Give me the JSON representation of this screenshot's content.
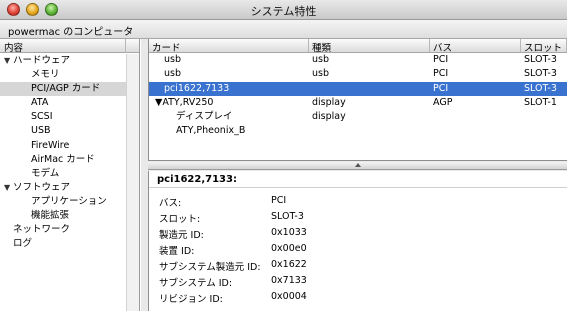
{
  "window": {
    "title": "システム特性"
  },
  "machine": {
    "name": "powermac のコンピュータ"
  },
  "sidebar": {
    "header": "内容",
    "items": [
      {
        "label": "ハードウェア",
        "level": 0,
        "disclosure": "▼"
      },
      {
        "label": "メモリ",
        "level": 1
      },
      {
        "label": "PCI/AGP カード",
        "level": 1,
        "selected": true
      },
      {
        "label": "ATA",
        "level": 1
      },
      {
        "label": "SCSI",
        "level": 1
      },
      {
        "label": "USB",
        "level": 1
      },
      {
        "label": "FireWire",
        "level": 1
      },
      {
        "label": "AirMac カード",
        "level": 1
      },
      {
        "label": "モデム",
        "level": 1
      },
      {
        "label": "ソフトウェア",
        "level": 0,
        "disclosure": "▼"
      },
      {
        "label": "アプリケーション",
        "level": 1
      },
      {
        "label": "機能拡張",
        "level": 1
      },
      {
        "label": "ネットワーク",
        "level": 0
      },
      {
        "label": "ログ",
        "level": 0
      }
    ]
  },
  "devices": {
    "columns": {
      "card": "カード",
      "type": "種類",
      "bus": "バス",
      "slot": "スロット"
    },
    "rows": [
      {
        "card": "usb",
        "type": "usb",
        "bus": "PCI",
        "slot": "SLOT-3"
      },
      {
        "card": "usb",
        "type": "usb",
        "bus": "PCI",
        "slot": "SLOT-3"
      },
      {
        "card": "pci1622,7133",
        "type": "",
        "bus": "PCI",
        "slot": "SLOT-3"
      },
      {
        "card": "ATY,RV250",
        "type": "display",
        "bus": "AGP",
        "slot": "SLOT-1",
        "disclosure": "▼"
      },
      {
        "card": "ディスプレイ",
        "type": "display",
        "bus": "",
        "slot": ""
      },
      {
        "card": "ATY,Pheonix_B",
        "type": "",
        "bus": "",
        "slot": ""
      }
    ]
  },
  "detail": {
    "title": "pci1622,7133:",
    "properties": [
      {
        "label": "バス:",
        "value": "PCI"
      },
      {
        "label": "スロット:",
        "value": "SLOT-3"
      },
      {
        "label": "製造元 ID:",
        "value": "0x1033"
      },
      {
        "label": "装置 ID:",
        "value": "0x00e0"
      },
      {
        "label": "サブシステム製造元 ID:",
        "value": "0x1622"
      },
      {
        "label": "サブシステム ID:",
        "value": "0x7133"
      },
      {
        "label": "リビジョン ID:",
        "value": "0x0004"
      }
    ]
  },
  "colors": {
    "selection": "#3a72cf",
    "sidebar_selection": "#d6d6d6"
  }
}
